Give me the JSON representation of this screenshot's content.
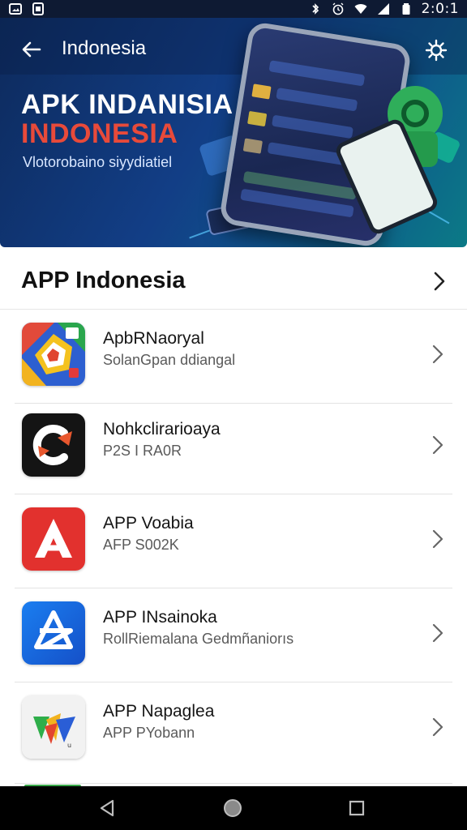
{
  "status_bar": {
    "time": "2:0:1",
    "left_icons": [
      "image-icon",
      "square-app-icon"
    ],
    "right_icons": [
      "bluetooth-icon",
      "alarm-icon",
      "wifi-icon",
      "signal-icon",
      "battery-icon"
    ]
  },
  "hero": {
    "title": "Indonesia",
    "headline_line1": "APK INDANISIA",
    "headline_line2": "INDONESIA",
    "tagline": "Vlotorobaino siyydiatiel",
    "colors": {
      "headline_line2": "#e84a3a",
      "background": "#123e86"
    }
  },
  "section": {
    "title": "APP Indonesia"
  },
  "apps": [
    {
      "name": "ApbRNaoryal",
      "subtitle": "SolanGpan ddiangal",
      "icon": "multicolor-ring-app-icon"
    },
    {
      "name": "Nohkclirarioaya",
      "subtitle": "P2S I RA0R",
      "icon": "black-c-arrow-app-icon"
    },
    {
      "name": "APP Voabia",
      "subtitle": "AFP S002K",
      "icon": "red-a-app-icon"
    },
    {
      "name": "APP INsainoka",
      "subtitle": "RollRiemalana Gedmñaniorıs",
      "icon": "blue-store-app-icon"
    },
    {
      "name": "APP Napaglea",
      "subtitle": "APP PYobann",
      "icon": "green-triangles-app-icon"
    }
  ],
  "nav_bar": {
    "buttons": [
      "back-triangle-icon",
      "home-circle-icon",
      "recents-square-icon"
    ]
  }
}
